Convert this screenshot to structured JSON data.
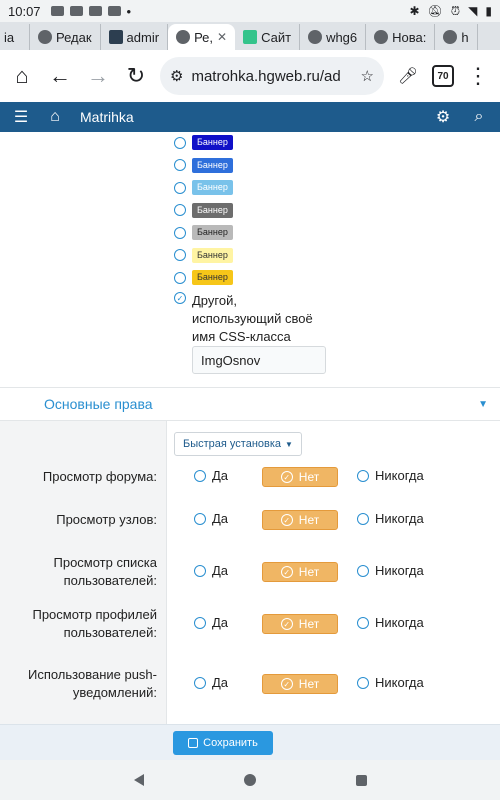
{
  "status": {
    "time": "10:07",
    "dot": "•"
  },
  "tabs": [
    {
      "label": "ia"
    },
    {
      "label": "Редак"
    },
    {
      "label": "admir"
    },
    {
      "label": "Ре,",
      "close": "✕"
    },
    {
      "label": "Сайт"
    },
    {
      "label": "whg6"
    },
    {
      "label": "Нова:"
    },
    {
      "label": "h"
    }
  ],
  "address": {
    "url": "matrohka.hgweb.ru/ad",
    "tab_count": "70"
  },
  "app": {
    "title": "Matrihka"
  },
  "banners": [
    {
      "label": "Баннер",
      "bg": "#1010c8",
      "fg": "#ffffff"
    },
    {
      "label": "Баннер",
      "bg": "#2f6fdb",
      "fg": "#ffffff"
    },
    {
      "label": "Баннер",
      "bg": "#79c2ea",
      "fg": "#ffffff"
    },
    {
      "label": "Баннер",
      "bg": "#6d6d6d",
      "fg": "#ffffff"
    },
    {
      "label": "Баннер",
      "bg": "#b9b9b9",
      "fg": "#222222"
    },
    {
      "label": "Баннер",
      "bg": "#fff4a3",
      "fg": "#333333"
    },
    {
      "label": "Баннер",
      "bg": "#f6c619",
      "fg": "#333333"
    }
  ],
  "other_option": {
    "text": "Другой, использующий своё имя CSS-класса",
    "value": "ImgOsnov"
  },
  "section": {
    "title": "Основные права",
    "quick_label": "Быстрая установка"
  },
  "permissions": [
    {
      "label_lines": [
        "Просмотр форума:"
      ]
    },
    {
      "label_lines": [
        "Просмотр узлов:"
      ]
    },
    {
      "label_lines": [
        "Просмотр списка",
        "пользователей:"
      ]
    },
    {
      "label_lines": [
        "Просмотр профилей",
        "пользователей:"
      ]
    },
    {
      "label_lines": [
        "Использование push-",
        "уведомлений:"
      ]
    }
  ],
  "options": {
    "yes": "Да",
    "no": "Нет",
    "never": "Никогда"
  },
  "save_label": "Сохранить",
  "colors": {
    "accent": "#2a8fd0",
    "appbar": "#1e5b8c",
    "no_pill": "#f0b664"
  }
}
